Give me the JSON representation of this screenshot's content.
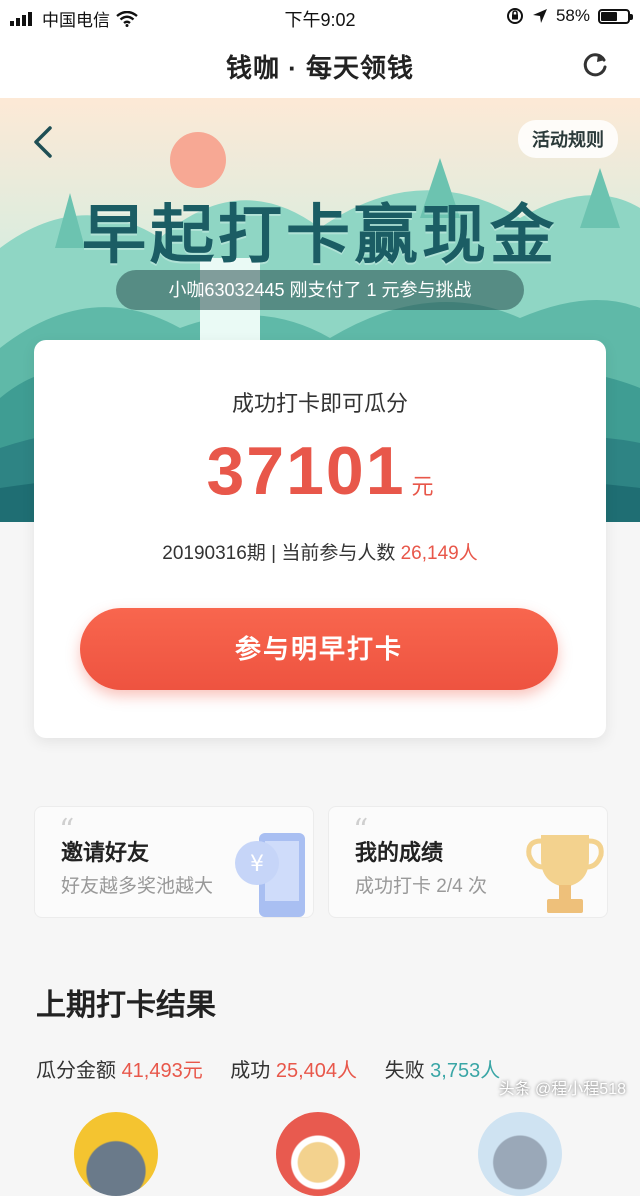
{
  "status_bar": {
    "carrier": "中国电信",
    "time": "下午9:02",
    "battery": "58%",
    "battery_level": 0.58
  },
  "nav": {
    "title": "钱咖 · 每天领钱"
  },
  "banner": {
    "rules_label": "活动规则",
    "headline": "早起打卡赢现金",
    "ticker": "小咖63032445 刚支付了 1 元参与挑战"
  },
  "card": {
    "label": "成功打卡即可瓜分",
    "amount": "37101",
    "unit": "元",
    "period": "20190316期",
    "separator": "|",
    "participants_label": "当前参与人数",
    "participants_value": "26,149人",
    "cta": "参与明早打卡"
  },
  "tiles": [
    {
      "title": "邀请好友",
      "subtitle": "好友越多奖池越大",
      "icon": "phone-yuan-icon"
    },
    {
      "title": "我的成绩",
      "subtitle": "成功打卡 2/4 次",
      "icon": "trophy-icon"
    }
  ],
  "results": {
    "title": "上期打卡结果",
    "split_label": "瓜分金额",
    "split_value": "41,493元",
    "success_label": "成功",
    "success_value": "25,404人",
    "fail_label": "失败",
    "fail_value": "3,753人"
  },
  "watermark": "头条 @程小程518",
  "colors": {
    "accent": "#e8574a",
    "headline": "#1b5d64",
    "teal": "#3aa6a6"
  }
}
